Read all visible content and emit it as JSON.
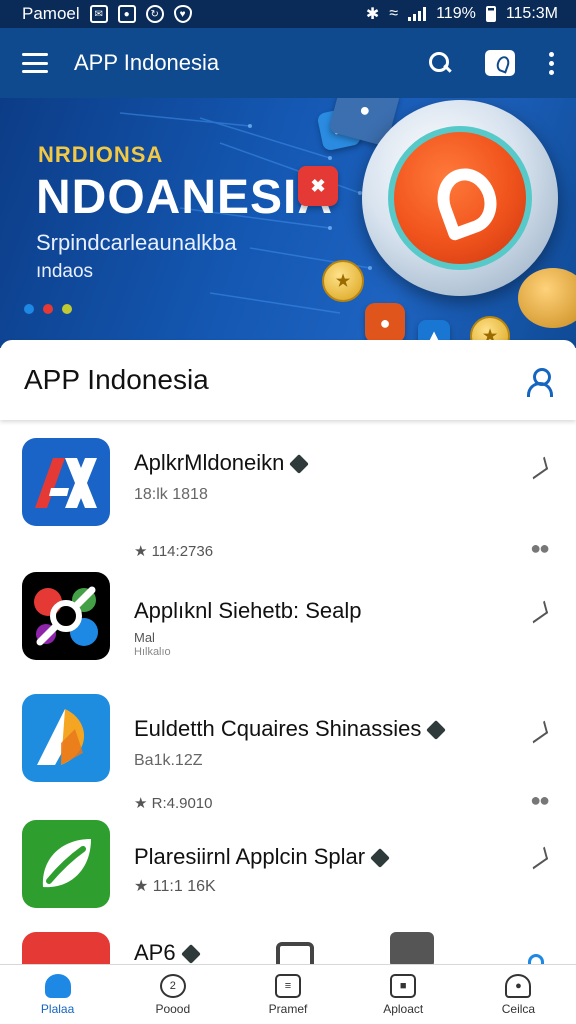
{
  "status_bar": {
    "carrier": "Pamoel",
    "time": "115:3M",
    "battery_text": "119%"
  },
  "app_bar": {
    "title": "APP Indonesia"
  },
  "banner": {
    "kicker": "NRDIONSA",
    "title": "NDOANESIA",
    "subtitle": "Srpindcarleaunalkba",
    "subtitle2": "ındaos"
  },
  "section": {
    "title": "APP Indonesia"
  },
  "apps": [
    {
      "name": "AplkrMldoneikn",
      "meta": "18:lk 1818",
      "meta2": "",
      "rating": "★ 114:2736",
      "verified": true
    },
    {
      "name": "Applıknl Siehetb: Sealp",
      "meta": "Mal",
      "meta2": "Hılkalıo",
      "rating": "",
      "verified": false
    },
    {
      "name": "Euldetth Cquaires Shinassies",
      "meta": "Ba1k.12Z",
      "meta2": "",
      "rating": "★ R:4.9010",
      "verified": true
    },
    {
      "name": "Plaresiirnl Applcin Splar",
      "meta": "",
      "meta2": "",
      "rating": "★ 11:1 16K",
      "verified": true
    },
    {
      "name": "AP6",
      "meta": "",
      "meta2": "",
      "rating": "",
      "verified": true
    }
  ],
  "bottom_nav": [
    {
      "label": "Plalaa",
      "icon": "home-icon",
      "active": true
    },
    {
      "label": "Poood",
      "icon": "chat-icon",
      "active": false
    },
    {
      "label": "Pramef",
      "icon": "list-icon",
      "active": false
    },
    {
      "label": "Aploact",
      "icon": "folder-icon",
      "active": false
    },
    {
      "label": "Ceilca",
      "icon": "profile-icon",
      "active": false
    }
  ],
  "colors": {
    "status_bar": "#0a2a57",
    "app_bar": "#0f4a8f",
    "accent": "#1565c0",
    "banner_kicker": "#f2c945"
  }
}
